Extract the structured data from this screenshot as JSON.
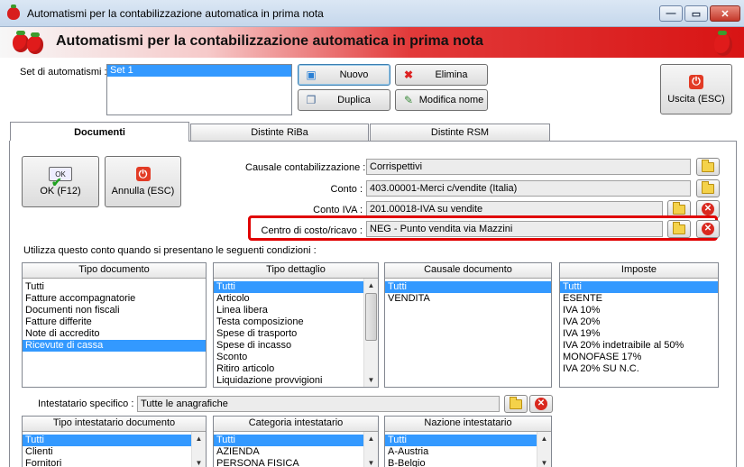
{
  "window": {
    "title": "Automatismi per la contabilizzazione automatica in prima nota",
    "min_glyph": "—",
    "max_glyph": "▭",
    "close_glyph": "✕"
  },
  "header": {
    "title": "Automatismi per la contabilizzazione automatica in prima nota"
  },
  "set": {
    "label": "Set di automatismi :",
    "items": [
      "Set 1"
    ],
    "selected_index": 0
  },
  "toolbar": {
    "nuovo_label": "Nuovo",
    "elimina_label": "Elimina",
    "duplica_label": "Duplica",
    "modifica_label": "Modifica nome",
    "uscita_label": "Uscita (ESC)"
  },
  "tabs": [
    {
      "label": "Documenti",
      "active": true
    },
    {
      "label": "Distinte RiBa",
      "active": false
    },
    {
      "label": "Distinte RSM",
      "active": false
    }
  ],
  "actions": {
    "ok_label": "OK (F12)",
    "ok_icon_text": "OK",
    "annulla_label": "Annulla (ESC)"
  },
  "fields": {
    "causale_label": "Causale contabilizzazione :",
    "causale_value": "Corrispettivi",
    "conto_label": "Conto :",
    "conto_value": "403.00001-Merci c/vendite (Italia)",
    "conto_iva_label": "Conto IVA :",
    "conto_iva_value": "201.00018-IVA su vendite",
    "centro_label": "Centro di costo/ricavo :",
    "centro_value": "NEG - Punto vendita via Mazzini"
  },
  "conditions_label": "Utilizza questo conto quando si presentano le seguenti condizioni :",
  "lists": {
    "tipo_documento": {
      "header": "Tipo documento",
      "items": [
        "Tutti",
        "Fatture accompagnatorie",
        "Documenti non fiscali",
        "Fatture differite",
        "Note di accredito",
        "Ricevute di cassa"
      ],
      "selected_index": 5
    },
    "tipo_dettaglio": {
      "header": "Tipo dettaglio",
      "items": [
        "Tutti",
        "Articolo",
        "Linea libera",
        "Testa composizione",
        "Spese di trasporto",
        "Spese di incasso",
        "Sconto",
        "Ritiro articolo",
        "Liquidazione provvigioni"
      ],
      "selected_index": 0
    },
    "causale_documento": {
      "header": "Causale documento",
      "items": [
        "Tutti",
        "VENDITA"
      ],
      "selected_index": 0
    },
    "imposte": {
      "header": "Imposte",
      "items": [
        "Tutti",
        "ESENTE",
        "IVA 10%",
        "IVA 20%",
        "IVA 19%",
        "IVA 20% indetraibile al 50%",
        "MONOFASE 17%",
        "IVA 20% SU N.C."
      ],
      "selected_index": 0
    }
  },
  "intestatario": {
    "label": "Intestatario specifico :",
    "value": "Tutte le anagrafiche"
  },
  "lists2": {
    "tipo_intestatario": {
      "header": "Tipo intestatario documento",
      "items": [
        "Tutti",
        "Clienti",
        "Fornitori"
      ],
      "selected_index": 0
    },
    "categoria_intestatario": {
      "header": "Categoria intestatario",
      "items": [
        "Tutti",
        "AZIENDA",
        "PERSONA FISICA"
      ],
      "selected_index": 0
    },
    "nazione_intestatario": {
      "header": "Nazione intestatario",
      "items": [
        "Tutti",
        "A-Austria",
        "B-Belgio"
      ],
      "selected_index": 0
    }
  },
  "colors": {
    "selection": "#3399ff",
    "highlight_border": "#e00000",
    "banner_red": "#d81414"
  },
  "icons": {
    "app": "strawberry-icon",
    "nuovo": "new-record-icon",
    "elimina": "red-x-icon",
    "duplica": "duplicate-icon",
    "modifica": "edit-name-icon",
    "uscita": "power-icon",
    "ok": "ok-checkmark-icon",
    "annulla": "power-icon",
    "browse": "folder-icon",
    "clear": "clear-x-icon"
  }
}
